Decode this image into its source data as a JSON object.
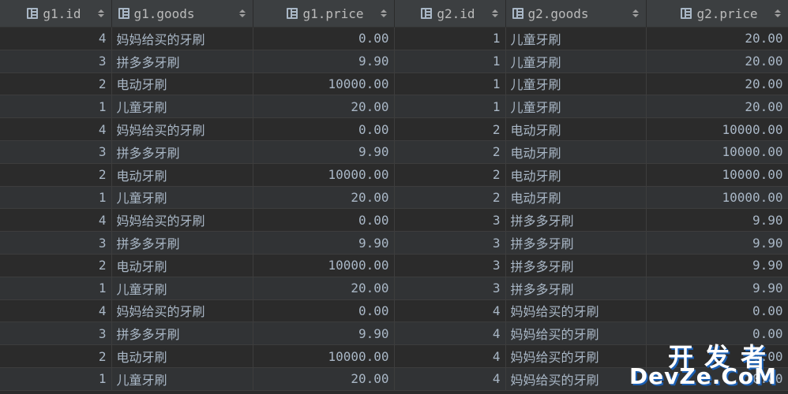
{
  "grid": {
    "columns": [
      {
        "label": "g1.id",
        "icon": "column-icon"
      },
      {
        "label": "g1.goods",
        "icon": "column-icon"
      },
      {
        "label": "g1.price",
        "icon": "column-icon"
      },
      {
        "label": "g2.id",
        "icon": "column-icon"
      },
      {
        "label": "g2.goods",
        "icon": "column-icon"
      },
      {
        "label": "g2.price",
        "icon": "column-icon"
      }
    ],
    "rows": [
      [
        "4",
        "妈妈给买的牙刷",
        "0.00",
        "1",
        "儿童牙刷",
        "20.00"
      ],
      [
        "3",
        "拼多多牙刷",
        "9.90",
        "1",
        "儿童牙刷",
        "20.00"
      ],
      [
        "2",
        "电动牙刷",
        "10000.00",
        "1",
        "儿童牙刷",
        "20.00"
      ],
      [
        "1",
        "儿童牙刷",
        "20.00",
        "1",
        "儿童牙刷",
        "20.00"
      ],
      [
        "4",
        "妈妈给买的牙刷",
        "0.00",
        "2",
        "电动牙刷",
        "10000.00"
      ],
      [
        "3",
        "拼多多牙刷",
        "9.90",
        "2",
        "电动牙刷",
        "10000.00"
      ],
      [
        "2",
        "电动牙刷",
        "10000.00",
        "2",
        "电动牙刷",
        "10000.00"
      ],
      [
        "1",
        "儿童牙刷",
        "20.00",
        "2",
        "电动牙刷",
        "10000.00"
      ],
      [
        "4",
        "妈妈给买的牙刷",
        "0.00",
        "3",
        "拼多多牙刷",
        "9.90"
      ],
      [
        "3",
        "拼多多牙刷",
        "9.90",
        "3",
        "拼多多牙刷",
        "9.90"
      ],
      [
        "2",
        "电动牙刷",
        "10000.00",
        "3",
        "拼多多牙刷",
        "9.90"
      ],
      [
        "1",
        "儿童牙刷",
        "20.00",
        "3",
        "拼多多牙刷",
        "9.90"
      ],
      [
        "4",
        "妈妈给买的牙刷",
        "0.00",
        "4",
        "妈妈给买的牙刷",
        "0.00"
      ],
      [
        "3",
        "拼多多牙刷",
        "9.90",
        "4",
        "妈妈给买的牙刷",
        "0.00"
      ],
      [
        "2",
        "电动牙刷",
        "10000.00",
        "4",
        "妈妈给买的牙刷",
        "0.00"
      ],
      [
        "1",
        "儿童牙刷",
        "20.00",
        "4",
        "妈妈给买的牙刷",
        "0.00"
      ]
    ]
  },
  "watermark": {
    "line1": "开发者",
    "line2": "DevZe.CoM"
  },
  "colors": {
    "background": "#2b2b2b",
    "header_background": "#3c3f41",
    "text": "#a9b7c6"
  }
}
